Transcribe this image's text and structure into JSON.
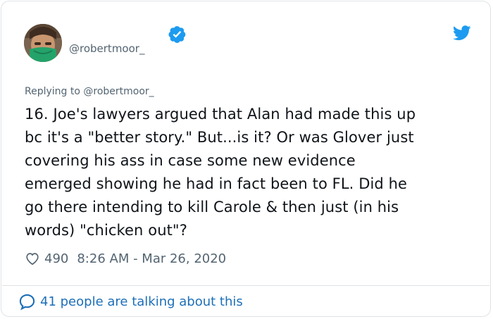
{
  "tweet": {
    "handle": "@robertmoor_",
    "replying_prefix": "Replying to",
    "replying_to": "@robertmoor_",
    "lines": [
      "16. Joe's lawyers argued that Alan had made this up",
      "bc it's a \"better story.\" But...is it? Or was Glover just",
      "covering his ass in case some new evidence",
      "emerged showing he had in fact been to FL. Did he",
      "go there intending to kill Carole & then just (in his",
      "words) \"chicken out\"?"
    ],
    "like_count": "490",
    "timestamp": "8:26 AM - Mar 26, 2020",
    "conversation_label": "41 people are talking about this"
  },
  "icons": {
    "verified": "verified-badge-icon",
    "brand": "twitter-bird-icon",
    "like": "heart-icon",
    "reply": "speech-bubble-icon"
  },
  "colors": {
    "accent": "#1d9bf0",
    "link": "#1d6fb8",
    "text": "#0f1419",
    "muted": "#536471"
  }
}
